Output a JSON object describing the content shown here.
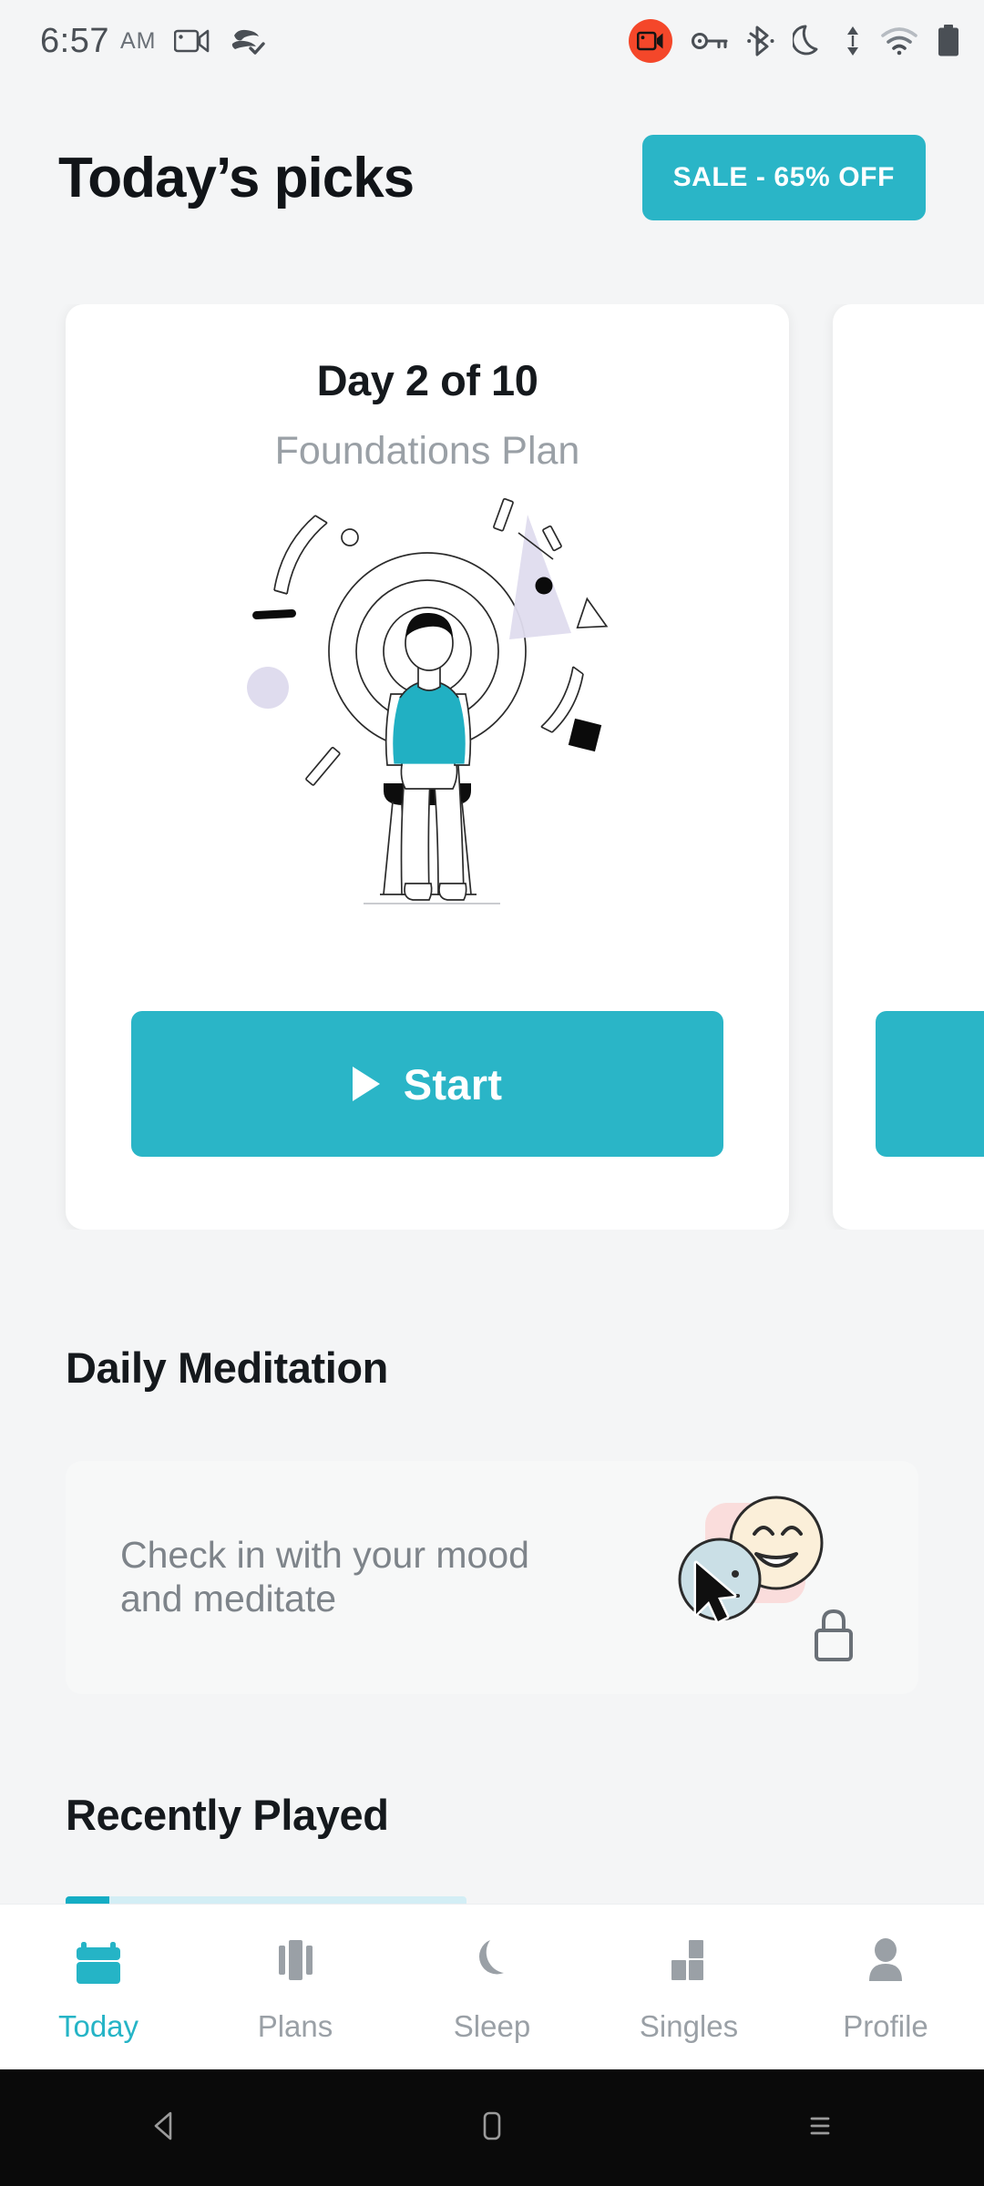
{
  "status_bar": {
    "time": "6:57",
    "meridiem": "AM",
    "icons": [
      {
        "name": "screen-record-icon",
        "label": "screen recording"
      },
      {
        "name": "vpn-check-icon",
        "label": "vpn connected"
      },
      {
        "name": "screen-record-active-icon",
        "label": "recording active"
      },
      {
        "name": "vpn-key-icon",
        "label": "vpn key"
      },
      {
        "name": "bluetooth-icon",
        "label": "bluetooth"
      },
      {
        "name": "do-not-disturb-moon-icon",
        "label": "do not disturb"
      },
      {
        "name": "data-transfer-icon",
        "label": "data transfer"
      },
      {
        "name": "wifi-icon",
        "label": "wifi"
      },
      {
        "name": "battery-icon",
        "label": "battery"
      }
    ],
    "recording_badge_color": "#f4472a"
  },
  "header": {
    "title": "Today’s picks",
    "sale_label": "SALE - 65% OFF",
    "accent_color": "#2ab5c7"
  },
  "picks": {
    "cards": [
      {
        "day": "Day 2 of 10",
        "plan": "Foundations Plan",
        "button_label": "Start",
        "illustration": "person-meditating-on-stool"
      },
      {
        "day": "",
        "plan": "",
        "button_label": "",
        "illustration": ""
      }
    ]
  },
  "daily_meditation": {
    "title": "Daily Meditation",
    "card_text": "Check in with your mood and meditate",
    "locked": true,
    "art": {
      "happy_face_color": "#fbefd9",
      "neutral_face_color": "#cadfe6",
      "pink_square_color": "#fadddc"
    }
  },
  "recently_played": {
    "title": "Recently Played",
    "progress_percent": 11,
    "track_color": "#d3eef5",
    "fill_color": "#14adc4"
  },
  "bottom_nav": {
    "active": "Today",
    "items": [
      {
        "label": "Today",
        "icon": "calendar-icon",
        "active": true
      },
      {
        "label": "Plans",
        "icon": "columns-icon",
        "active": false
      },
      {
        "label": "Sleep",
        "icon": "moon-icon",
        "active": false
      },
      {
        "label": "Singles",
        "icon": "blocks-icon",
        "active": false
      },
      {
        "label": "Profile",
        "icon": "person-icon",
        "active": false
      }
    ],
    "active_color": "#25b4c6",
    "inactive_color": "#9aa0a6"
  },
  "android_nav": {
    "buttons": [
      {
        "name": "back-button",
        "icon": "triangle-left-icon"
      },
      {
        "name": "home-button",
        "icon": "rounded-square-icon"
      },
      {
        "name": "recents-button",
        "icon": "hamburger-lines-icon"
      }
    ]
  }
}
